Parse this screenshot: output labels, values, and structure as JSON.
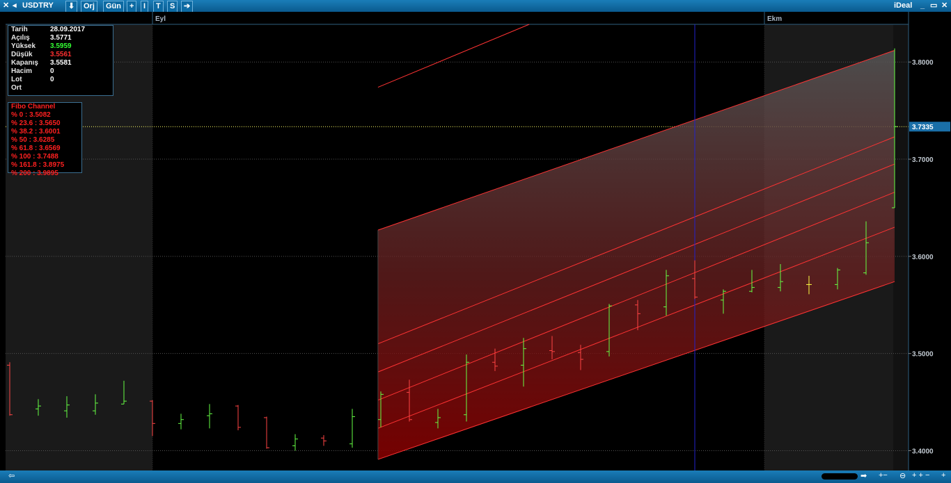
{
  "toolbar": {
    "symbol": "USDTRY",
    "buttons": [
      {
        "name": "down-arrow-button",
        "icon": "arrow-down-icon",
        "glyph": "⬇"
      },
      {
        "name": "orj-button",
        "label": "Orj"
      },
      {
        "name": "gun-button",
        "label": "Gün"
      },
      {
        "name": "plus-button",
        "label": "+"
      },
      {
        "name": "i-button",
        "label": "I"
      },
      {
        "name": "t-button",
        "label": "T"
      },
      {
        "name": "s-button",
        "label": "S"
      },
      {
        "name": "right-arrow-button",
        "icon": "arrow-right-icon",
        "glyph": "➔"
      }
    ],
    "brand": "iDeal"
  },
  "info_panel": {
    "rows": [
      {
        "label": "Tarih",
        "value": "28.09.2017",
        "color": "#ffffff"
      },
      {
        "label": "Açılış",
        "value": "3.5771",
        "color": "#ffffff"
      },
      {
        "label": "Yüksek",
        "value": "3.5959",
        "color": "#33ff33"
      },
      {
        "label": "Düşük",
        "value": "3.5561",
        "color": "#ff3030"
      },
      {
        "label": "Kapanış",
        "value": "3.5581",
        "color": "#ffffff"
      },
      {
        "label": "Hacim",
        "value": "0",
        "color": "#ffffff"
      },
      {
        "label": "Lot",
        "value": "0",
        "color": "#ffffff"
      },
      {
        "label": "Ort",
        "value": "",
        "color": "#ffffff"
      }
    ]
  },
  "fibo_panel": {
    "title": "Fibo Channel",
    "levels": [
      "% 0 :  3.5082",
      "% 23.6 :  3.5650",
      "% 38.2 :  3.6001",
      "% 50 :  3.6285",
      "% 61.8 :  3.6569",
      "% 100 :  3.7488",
      "% 161.8 :  3.8975",
      "% 200 :  3.9895"
    ]
  },
  "chart_data": {
    "type": "ohlc",
    "symbol": "USDTRY",
    "period": "Gün",
    "month_labels": [
      {
        "label": "Eyl",
        "bar_index": 5
      },
      {
        "label": "Ekm",
        "bar_index": 26
      }
    ],
    "y_ticks": [
      3.4,
      3.5,
      3.6,
      3.7,
      3.8
    ],
    "ylim": [
      3.3796,
      3.8388
    ],
    "current_price": {
      "value": "3.7335",
      "color": "#ffff66"
    },
    "crosshair_bar_index": 24,
    "bars": [
      {
        "o": 3.488,
        "h": 3.491,
        "l": 3.436,
        "c": 3.437
      },
      {
        "o": 3.443,
        "h": 3.453,
        "l": 3.436,
        "c": 3.446
      },
      {
        "o": 3.441,
        "h": 3.456,
        "l": 3.434,
        "c": 3.447
      },
      {
        "o": 3.441,
        "h": 3.458,
        "l": 3.437,
        "c": 3.449
      },
      {
        "o": 3.448,
        "h": 3.472,
        "l": 3.448,
        "c": 3.451
      },
      {
        "o": 3.451,
        "h": 3.452,
        "l": 3.415,
        "c": 3.428
      },
      {
        "o": 3.428,
        "h": 3.438,
        "l": 3.422,
        "c": 3.432
      },
      {
        "o": 3.436,
        "h": 3.448,
        "l": 3.423,
        "c": 3.438
      },
      {
        "o": 3.446,
        "h": 3.447,
        "l": 3.421,
        "c": 3.424
      },
      {
        "o": 3.434,
        "h": 3.435,
        "l": 3.402,
        "c": 3.403
      },
      {
        "o": 3.405,
        "h": 3.417,
        "l": 3.4,
        "c": 3.412
      },
      {
        "o": 3.413,
        "h": 3.416,
        "l": 3.405,
        "c": 3.41
      },
      {
        "o": 3.407,
        "h": 3.443,
        "l": 3.403,
        "c": 3.435
      },
      {
        "o": 3.432,
        "h": 3.461,
        "l": 3.424,
        "c": 3.458
      },
      {
        "o": 3.46,
        "h": 3.473,
        "l": 3.43,
        "c": 3.432
      },
      {
        "o": 3.429,
        "h": 3.443,
        "l": 3.423,
        "c": 3.434
      },
      {
        "o": 3.437,
        "h": 3.499,
        "l": 3.43,
        "c": 3.491
      },
      {
        "o": 3.491,
        "h": 3.505,
        "l": 3.482,
        "c": 3.487
      },
      {
        "o": 3.488,
        "h": 3.516,
        "l": 3.466,
        "c": 3.505
      },
      {
        "o": 3.503,
        "h": 3.518,
        "l": 3.494,
        "c": 3.502
      },
      {
        "o": 3.501,
        "h": 3.509,
        "l": 3.483,
        "c": 3.494
      },
      {
        "o": 3.502,
        "h": 3.551,
        "l": 3.497,
        "c": 3.549
      },
      {
        "o": 3.55,
        "h": 3.555,
        "l": 3.524,
        "c": 3.541
      },
      {
        "o": 3.548,
        "h": 3.586,
        "l": 3.539,
        "c": 3.58
      },
      {
        "o": 3.5771,
        "h": 3.5959,
        "l": 3.5561,
        "c": 3.5581
      },
      {
        "o": 3.555,
        "h": 3.566,
        "l": 3.541,
        "c": 3.564
      },
      {
        "o": 3.564,
        "h": 3.586,
        "l": 3.563,
        "c": 3.568
      },
      {
        "o": 3.568,
        "h": 3.592,
        "l": 3.564,
        "c": 3.574
      },
      {
        "o": 3.571,
        "h": 3.58,
        "l": 3.561,
        "c": 3.571
      },
      {
        "o": 3.571,
        "h": 3.588,
        "l": 3.566,
        "c": 3.586
      },
      {
        "o": 3.583,
        "h": 3.636,
        "l": 3.581,
        "c": 3.614
      },
      {
        "o": 3.65,
        "h": 3.814,
        "l": 3.65,
        "c": 3.7335
      }
    ],
    "channel": {
      "start_bar": 12.9,
      "end_bar": 31,
      "lines": [
        {
          "level": 0,
          "y0": 3.391,
          "y1": 3.574
        },
        {
          "level": 23.6,
          "y0": 3.423,
          "y1": 3.63
        },
        {
          "level": 38.2,
          "y0": 3.452,
          "y1": 3.666
        },
        {
          "level": 50,
          "y0": 3.481,
          "y1": 3.695
        },
        {
          "level": 61.8,
          "y0": 3.51,
          "y1": 3.723
        },
        {
          "level": 100,
          "y0": 3.627,
          "y1": 3.812
        },
        {
          "level": 161.8,
          "y0": 3.774,
          "y1": 3.8388
        }
      ]
    },
    "colors": {
      "up": "#66ff44",
      "down": "#ff4444",
      "neutral": "#ffff44",
      "channel": "#ff3333",
      "grid": "#555555"
    }
  },
  "statusbar": {
    "left_icon": "arrow-left-icon",
    "right_icons": [
      "zoom-out-icon",
      "zoom-reset-icon",
      "zoom-in-icon",
      "scroll-right-icon"
    ]
  }
}
